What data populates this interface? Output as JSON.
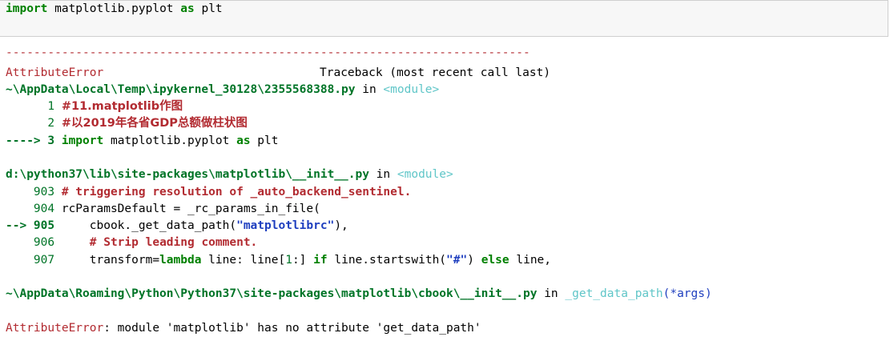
{
  "input_cell": {
    "kw_import": "import",
    "module": " matplotlib.pyplot ",
    "kw_as": "as",
    "alias": " plt"
  },
  "traceback": {
    "dashes": "---------------------------------------------------------------------------",
    "error_name": "AttributeError",
    "header_right": "Traceback (most recent call last)",
    "frame1": {
      "path": "~\\AppData\\Local\\Temp\\ipykernel_30128\\2355568388.py",
      "in": " in ",
      "func": "<module>",
      "l1_no": "      1 ",
      "l1_text": "#11.matplotlib作图",
      "l2_no": "      2 ",
      "l2_text": "#以2019年各省GDP总额做柱状图",
      "l3_arrow": "----> 3 ",
      "l3_kw_import": "import",
      "l3_mod": " matplotlib.pyplot ",
      "l3_kw_as": "as",
      "l3_alias": " plt"
    },
    "frame2": {
      "path": "d:\\python37\\lib\\site-packages\\matplotlib\\__init__.py",
      "in": " in ",
      "func": "<module>",
      "l903_no": "    903 ",
      "l903_text": "# triggering resolution of _auto_backend_sentinel.",
      "l904_no": "    904 ",
      "l904_text": "rcParamsDefault = _rc_params_in_file(",
      "l905_arrow": "--> 905 ",
      "l905_pre": "    cbook._get_data_path(",
      "l905_str": "\"matplotlibrc\"",
      "l905_post": "),",
      "l906_no": "    906 ",
      "l906_indent": "    ",
      "l906_text": "# Strip leading comment.",
      "l907_no": "    907 ",
      "l907_pre": "    transform=",
      "l907_kw_lambda": "lambda",
      "l907_mid": " line: line[",
      "l907_num": "1",
      "l907_mid2": ":] ",
      "l907_kw_if": "if",
      "l907_mid3": " line.startswith(",
      "l907_str": "\"#\"",
      "l907_mid4": ") ",
      "l907_kw_else": "else",
      "l907_end": " line,"
    },
    "frame3": {
      "path": "~\\AppData\\Roaming\\Python\\Python37\\site-packages\\matplotlib\\cbook\\__init__.py",
      "in": " in ",
      "func": "_get_data_path",
      "args": "(*args)"
    },
    "final_error_name": "AttributeError",
    "final_message": ": module 'matplotlib' has no attribute 'get_data_path'"
  }
}
